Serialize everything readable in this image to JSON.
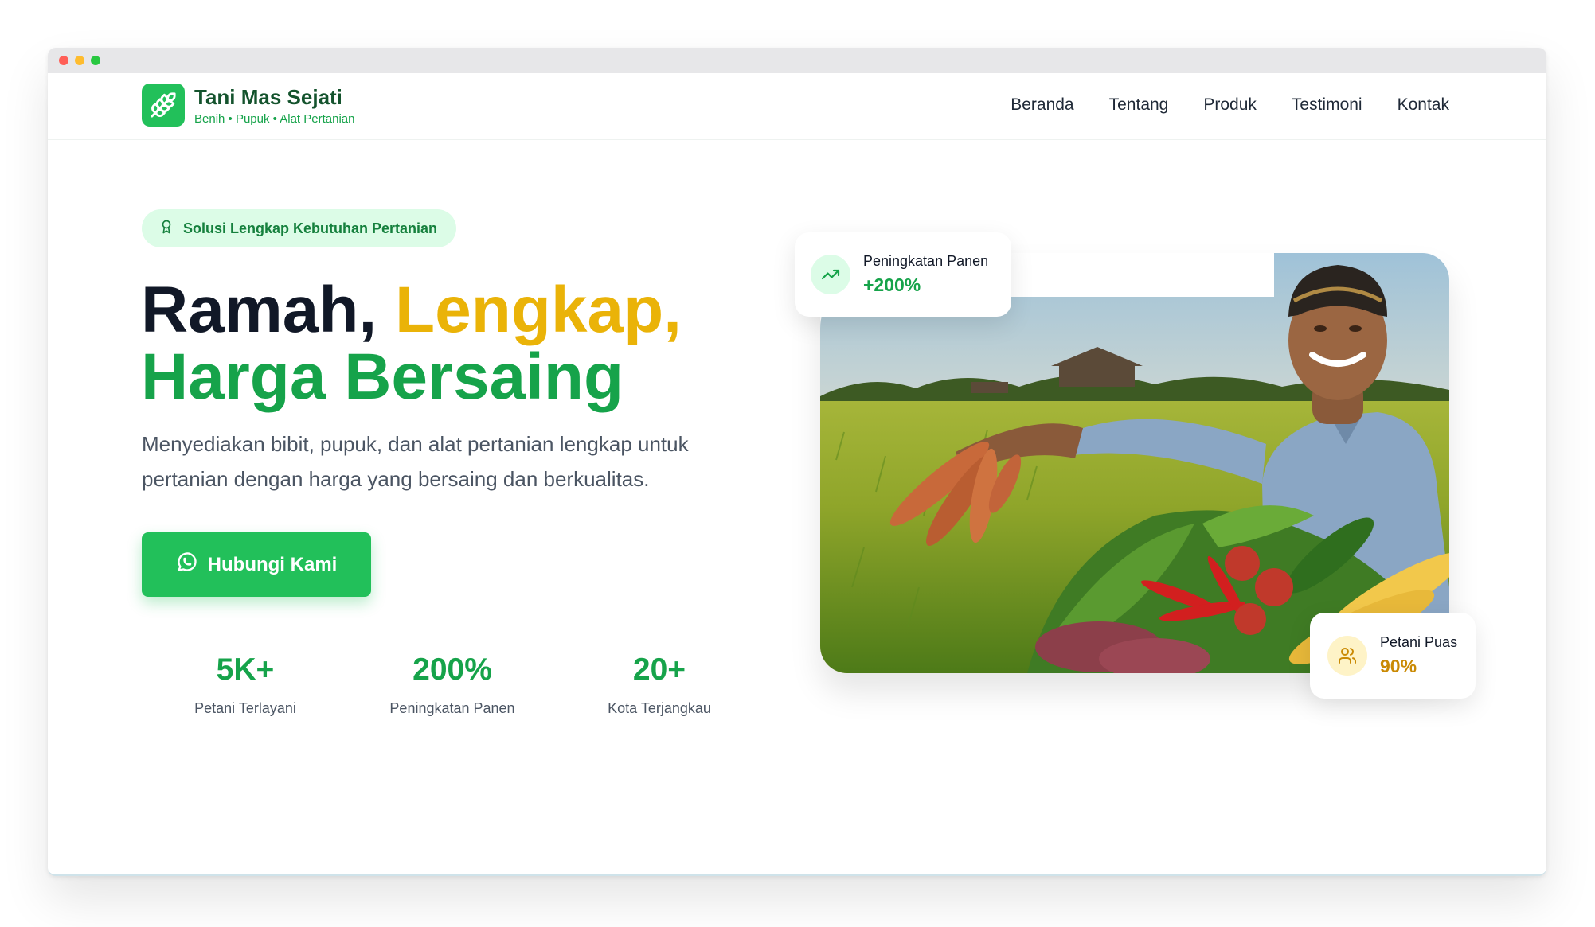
{
  "brand": {
    "name": "Tani Mas Sejati",
    "tagline": "Benih • Pupuk • Alat Pertanian",
    "logo_icon": "wheat-icon"
  },
  "nav": {
    "items": [
      "Beranda",
      "Tentang",
      "Produk",
      "Testimoni",
      "Kontak"
    ]
  },
  "hero": {
    "badge": {
      "icon": "award-icon",
      "text": "Solusi Lengkap Kebutuhan Pertanian"
    },
    "headline": {
      "part1": "Ramah, ",
      "part2": "Lengkap,",
      "line2": "Harga Bersaing"
    },
    "description": "Menyediakan bibit, pupuk, dan alat pertanian lengkap untuk pertanian dengan harga yang bersaing dan berkualitas.",
    "cta": {
      "label": "Hubungi Kami",
      "icon": "whatsapp-icon"
    },
    "stats": [
      {
        "value": "5K+",
        "label": "Petani Terlayani"
      },
      {
        "value": "200%",
        "label": "Peningkatan Panen"
      },
      {
        "value": "20+",
        "label": "Kota Terjangkau"
      }
    ]
  },
  "cards": {
    "harvest": {
      "label": "Peningkatan Panen",
      "value": "+200%",
      "icon": "trending-up-icon"
    },
    "satisfied": {
      "label": "Petani Puas",
      "value": "90%",
      "icon": "users-icon"
    }
  },
  "colors": {
    "primary": "#22c05a",
    "primary_dark": "#16a34a",
    "accent_gold": "#eab308",
    "heading_dark": "#111827"
  }
}
